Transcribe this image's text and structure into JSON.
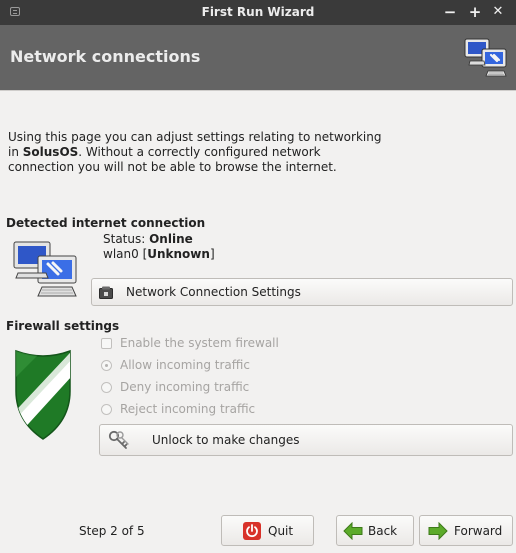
{
  "window": {
    "title": "First Run Wizard",
    "minimize_glyph": "−",
    "maximize_glyph": "+",
    "close_glyph": "✕"
  },
  "header": {
    "title": "Network connections",
    "icon": "network-computers-icon"
  },
  "intro": {
    "line1": "Using this page you can adjust settings relating to networking",
    "line2_prefix": "in ",
    "line2_bold": "SolusOS",
    "line2_suffix": ". Without a correctly configured network",
    "line3": "connection you will not be able to browse the internet."
  },
  "detected": {
    "section_title": "Detected internet connection",
    "status_label": "Status: ",
    "status_value": "Online",
    "interface_name": "wlan0",
    "interface_state_prefix": "  [",
    "interface_state": "Unknown",
    "interface_state_suffix": "]",
    "settings_button": "Network Connection Settings"
  },
  "firewall": {
    "section_title": "Firewall settings",
    "enable_label": "Enable the system firewall",
    "options": [
      {
        "label": "Allow incoming traffic",
        "selected": true
      },
      {
        "label": "Deny incoming traffic",
        "selected": false
      },
      {
        "label": "Reject incoming traffic",
        "selected": false
      }
    ],
    "unlock_button": "Unlock to make changes"
  },
  "footer": {
    "step": "Step 2 of 5",
    "quit": "Quit",
    "back": "Back",
    "forward": "Forward"
  },
  "colors": {
    "titlebar": "#3a3a3a",
    "banner": "#646464",
    "window_bg": "#f2f1f0",
    "shield_green": "#2a8a2f",
    "quit_red": "#d8322a",
    "arrow_green": "#5cab2a"
  }
}
